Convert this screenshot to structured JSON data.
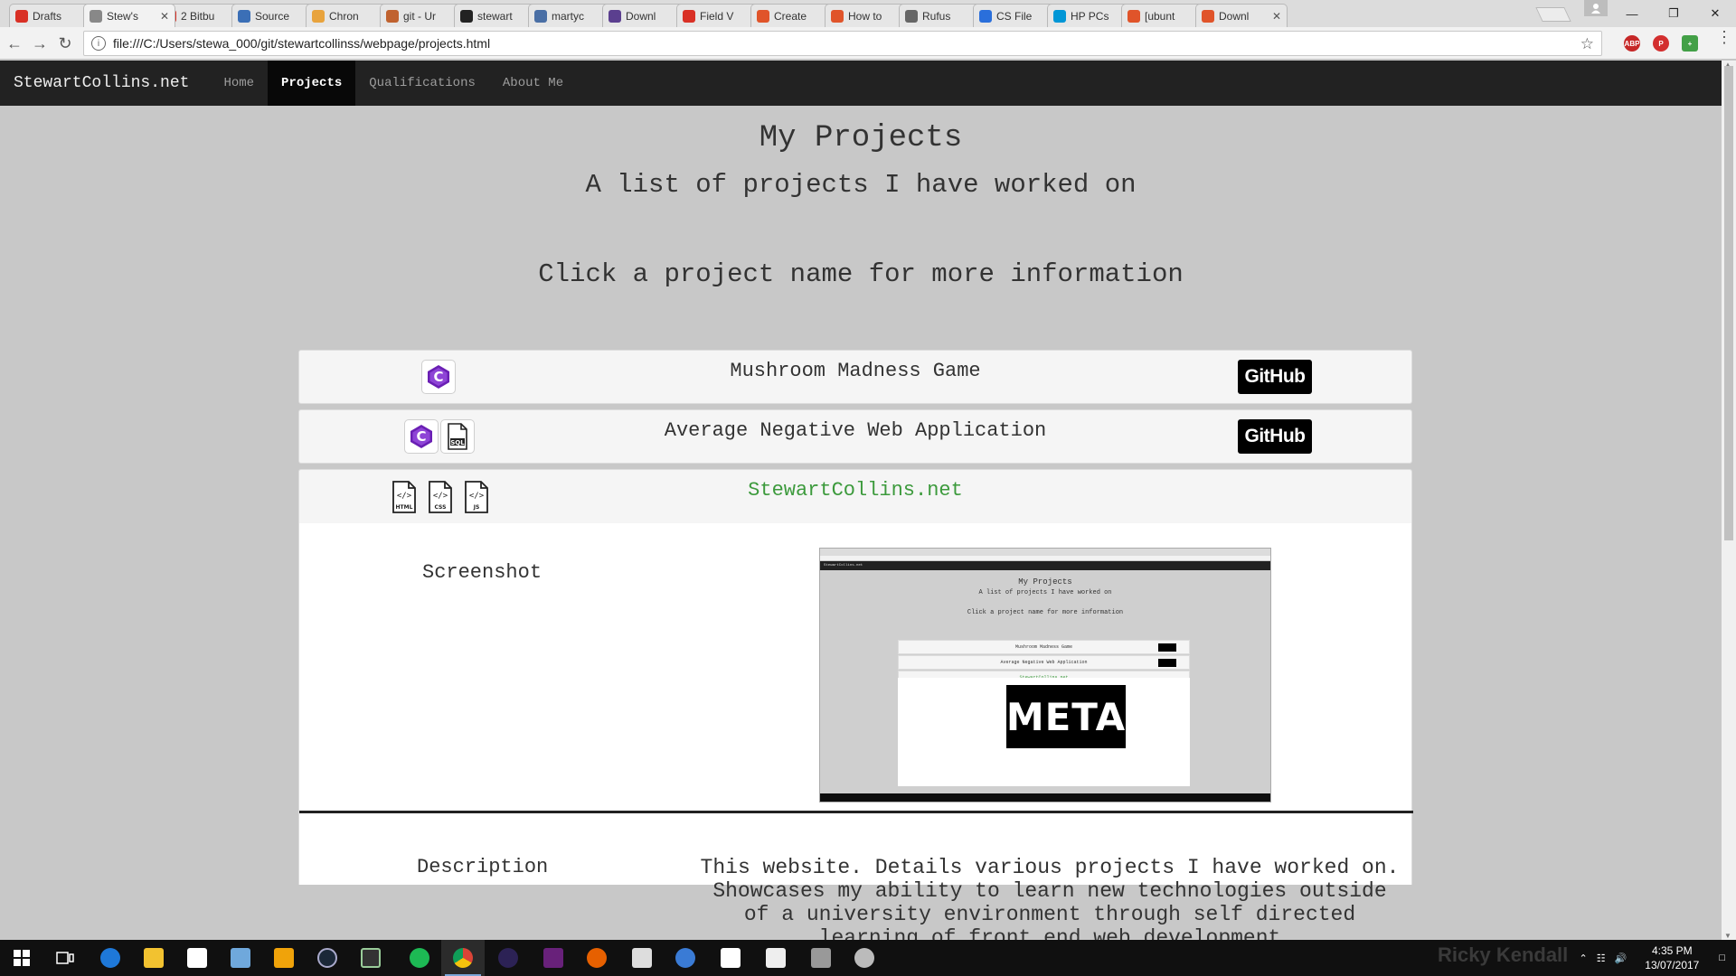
{
  "browser": {
    "tabs": [
      {
        "label": "Drafts",
        "color": "#d93025"
      },
      {
        "label": "Stew's",
        "color": "#888888",
        "active": true
      },
      {
        "label": "2 Bitbu",
        "color": "#d93025"
      },
      {
        "label": "Source",
        "color": "#3b6fb6"
      },
      {
        "label": "Chron",
        "color": "#e8a33d"
      },
      {
        "label": "git - Ur",
        "color": "#c0622f"
      },
      {
        "label": "stewart",
        "color": "#222222"
      },
      {
        "label": "martyc",
        "color": "#4a6fa5"
      },
      {
        "label": "Downl",
        "color": "#5b3f8f"
      },
      {
        "label": "Field V",
        "color": "#d93025"
      },
      {
        "label": "Create",
        "color": "#e0542a"
      },
      {
        "label": "How to",
        "color": "#e0542a"
      },
      {
        "label": "Rufus",
        "color": "#666666"
      },
      {
        "label": "CS File",
        "color": "#2a6fdb"
      },
      {
        "label": "HP PCs",
        "color": "#0096d6"
      },
      {
        "label": "[ubunt",
        "color": "#e0542a"
      },
      {
        "label": "Downl",
        "color": "#e0542a"
      }
    ],
    "url": "file:///C:/Users/stewa_000/git/stewartcollinss/webpage/projects.html"
  },
  "site": {
    "brand": "StewartCollins.net",
    "nav": [
      "Home",
      "Projects",
      "Qualifications",
      "About Me"
    ],
    "active_nav": "Projects"
  },
  "page": {
    "title": "My Projects",
    "subtitle": "A list of projects I have worked on",
    "instruction": "Click a project name for more information"
  },
  "projects": [
    {
      "name": "Mushroom Madness Game",
      "tech": [
        "c-sharp-icon"
      ],
      "github_label": "GitHub"
    },
    {
      "name": "Average Negative Web Application",
      "tech": [
        "c-sharp-icon",
        "sql-file-icon"
      ],
      "github_label": "GitHub"
    },
    {
      "name": "StewartCollins.net",
      "tech": [
        "html-file-icon",
        "css-file-icon",
        "js-file-icon"
      ],
      "expanded": true,
      "accent": "#3c9a3c"
    }
  ],
  "detail": {
    "screenshot_label": "Screenshot",
    "description_label": "Description",
    "description_text": "This website. Details various projects I have worked on. Showcases my ability to learn new technologies outside of a university environment through self directed learning of front end web development",
    "thumbnail": {
      "title": "My Projects",
      "subtitle": "A list of projects I have worked on",
      "instruction": "Click a project name for more information",
      "rows": [
        "Mushroom Madness Game",
        "Average Negative Web Application",
        "StewartCollins.net"
      ],
      "logo_text": "META"
    }
  },
  "icon_labels": {
    "sql": "SQL",
    "html": "HTML",
    "css": "CSS",
    "js": "JS"
  },
  "taskbar": {
    "time": "4:35 PM",
    "date": "13/07/2017",
    "watermark": "Ricky Kendall"
  }
}
